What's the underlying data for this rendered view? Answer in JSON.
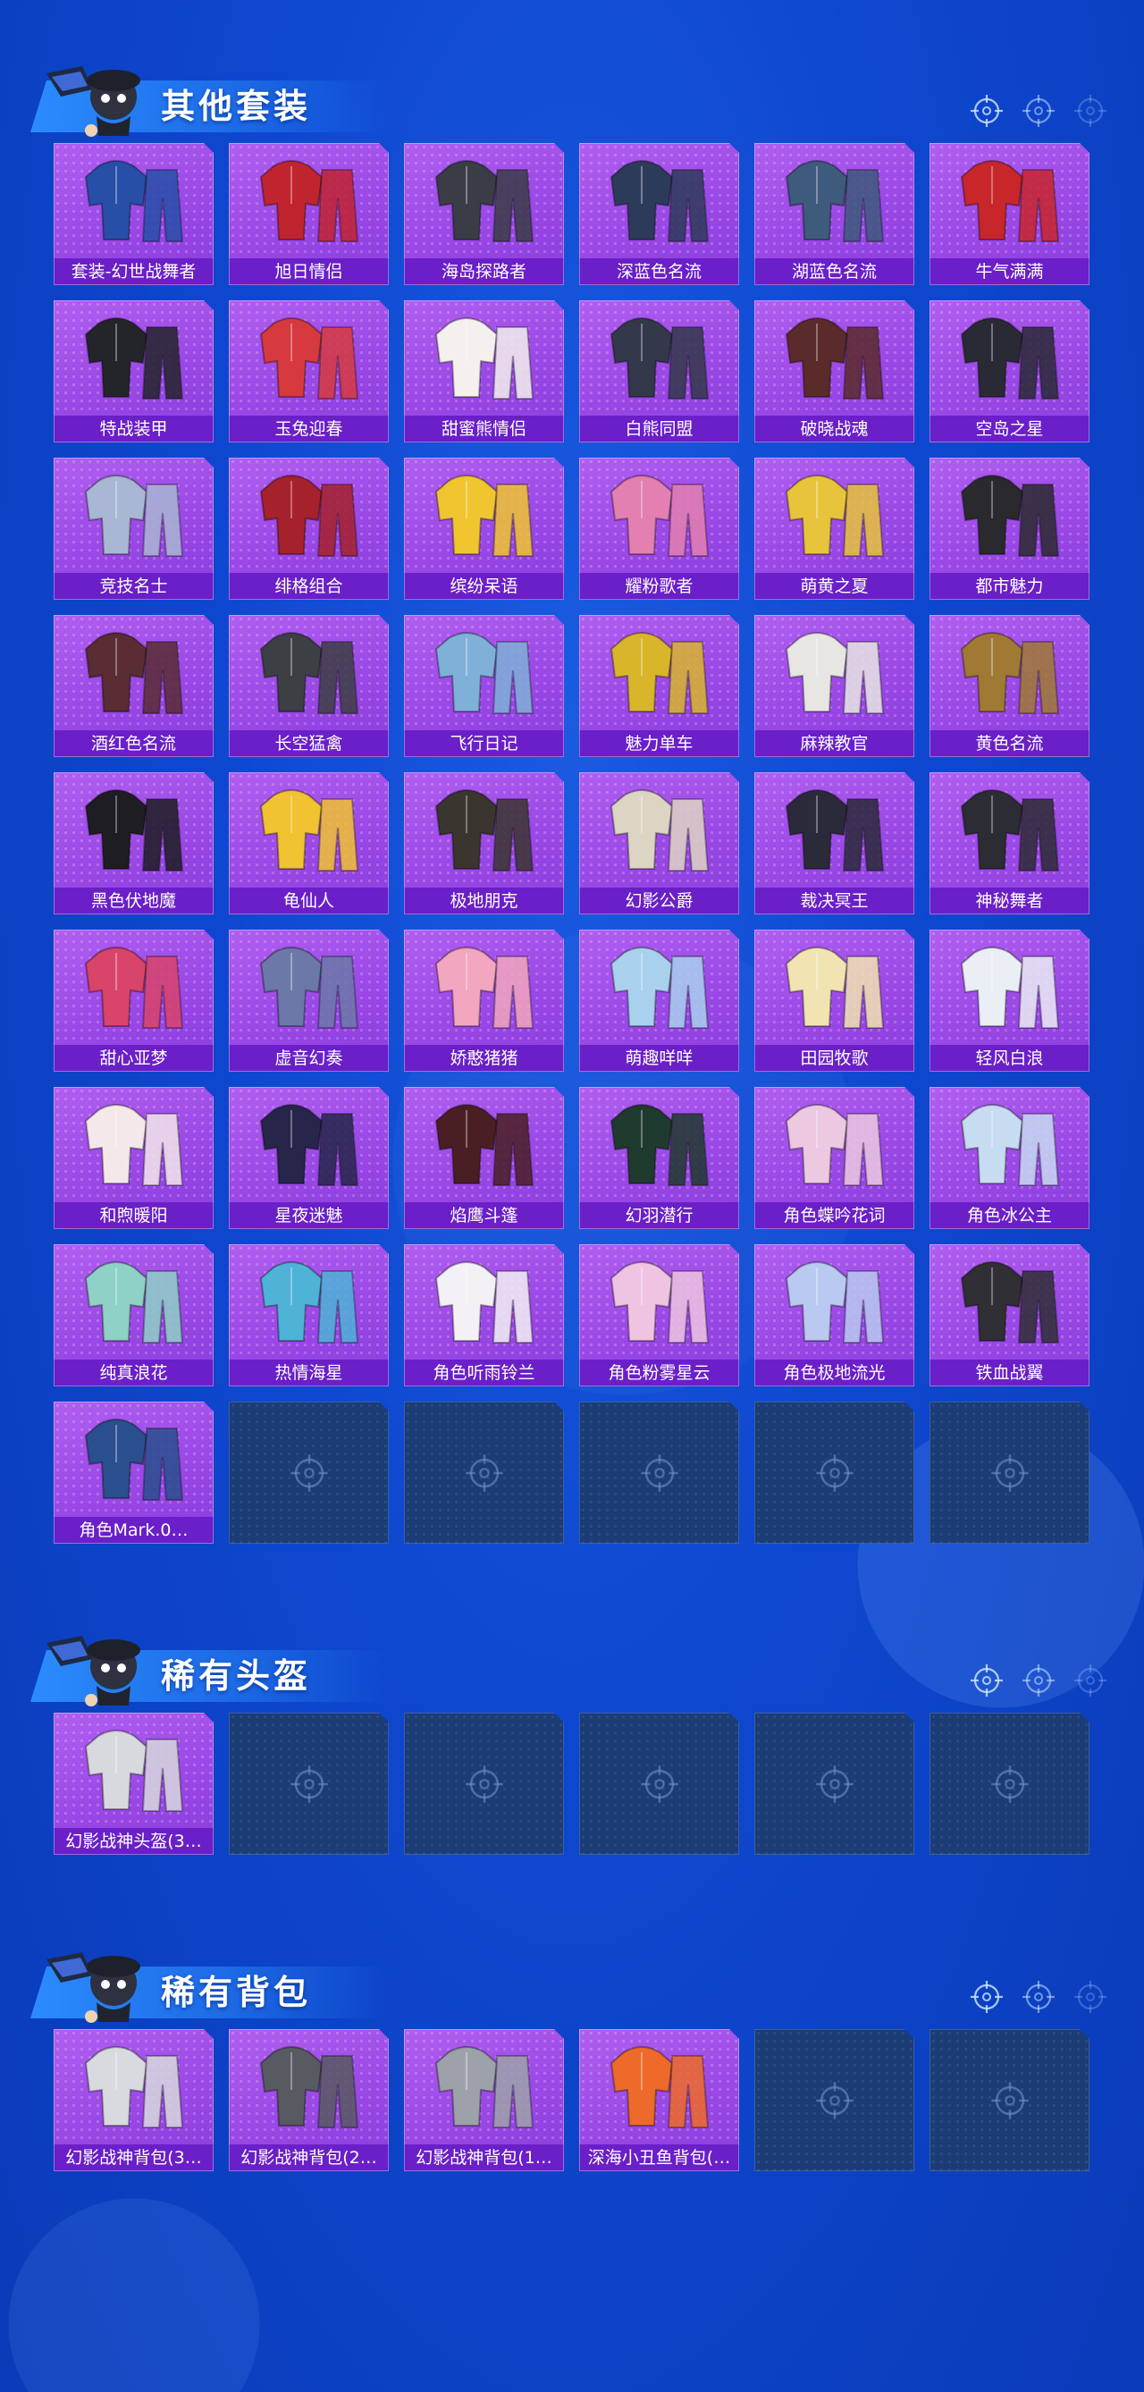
{
  "colors": {
    "background": "#0e47cf",
    "card_purple": "#9a48e6",
    "label_purple": "#6a1fc8",
    "empty_slot": "#1c3c76",
    "header_band": "#2b8cff"
  },
  "icons": {
    "mascot": "mascot-icon",
    "crosshair": "crosshair-icon"
  },
  "sections": [
    {
      "title": "其他套装",
      "items": [
        {
          "label": "套装-幻世战舞者",
          "art": "#274fa8"
        },
        {
          "label": "旭日情侣",
          "art": "#c0242f"
        },
        {
          "label": "海岛探路者",
          "art": "#3a3d46"
        },
        {
          "label": "深蓝色名流",
          "art": "#2d3b5a"
        },
        {
          "label": "湖蓝色名流",
          "art": "#3e5a7c"
        },
        {
          "label": "牛气满满",
          "art": "#c8262b"
        },
        {
          "label": "特战装甲",
          "art": "#23252b"
        },
        {
          "label": "玉兔迎春",
          "art": "#d63a3f"
        },
        {
          "label": "甜蜜熊情侣",
          "art": "#f3f0ee"
        },
        {
          "label": "白熊同盟",
          "art": "#33384a"
        },
        {
          "label": "破晓战魂",
          "art": "#5b2a2b"
        },
        {
          "label": "空岛之星",
          "art": "#2a2a36"
        },
        {
          "label": "竞技名士",
          "art": "#a9b6d4"
        },
        {
          "label": "绯格组合",
          "art": "#a5212b"
        },
        {
          "label": "缤纷呆语",
          "art": "#f1c530"
        },
        {
          "label": "耀粉歌者",
          "art": "#e37fb1"
        },
        {
          "label": "萌黄之夏",
          "art": "#e8c43c"
        },
        {
          "label": "都市魅力",
          "art": "#2a2a2e"
        },
        {
          "label": "酒红色名流",
          "art": "#5a2c34"
        },
        {
          "label": "长空猛禽",
          "art": "#3c3f44"
        },
        {
          "label": "飞行日记",
          "art": "#7fb0d8"
        },
        {
          "label": "魅力单车",
          "art": "#d9b52c"
        },
        {
          "label": "麻辣教官",
          "art": "#e8e6e3"
        },
        {
          "label": "黄色名流",
          "art": "#a07a34"
        },
        {
          "label": "黑色伏地魔",
          "art": "#1d1d22"
        },
        {
          "label": "龟仙人",
          "art": "#f1c232"
        },
        {
          "label": "极地朋克",
          "art": "#3a352f"
        },
        {
          "label": "幻影公爵",
          "art": "#ddd5c4"
        },
        {
          "label": "裁决冥王",
          "art": "#2b2a3a"
        },
        {
          "label": "神秘舞者",
          "art": "#2c2c34"
        },
        {
          "label": "甜心亚梦",
          "art": "#d9446a"
        },
        {
          "label": "虚音幻奏",
          "art": "#6c78a8"
        },
        {
          "label": "娇憨猪猪",
          "art": "#f3a6bf"
        },
        {
          "label": "萌趣咩咩",
          "art": "#a9d1ee"
        },
        {
          "label": "田园牧歌",
          "art": "#f2e4b2"
        },
        {
          "label": "轻风白浪",
          "art": "#eaeef5"
        },
        {
          "label": "和煦暖阳",
          "art": "#f4e8ea"
        },
        {
          "label": "星夜迷魅",
          "art": "#25264a"
        },
        {
          "label": "焰鹰斗篷",
          "art": "#4a1f24"
        },
        {
          "label": "幻羽潜行",
          "art": "#1f3a2e"
        },
        {
          "label": "角色蝶吟花词",
          "art": "#ecc9e1"
        },
        {
          "label": "角色冰公主",
          "art": "#c7dbf1"
        },
        {
          "label": "纯真浪花",
          "art": "#8fd0c7"
        },
        {
          "label": "热情海星",
          "art": "#4fb3d8"
        },
        {
          "label": "角色听雨铃兰",
          "art": "#f3f1f5"
        },
        {
          "label": "角色粉雾星云",
          "art": "#efc4e3"
        },
        {
          "label": "角色极地流光",
          "art": "#b9c9f1"
        },
        {
          "label": "铁血战翼",
          "art": "#2f2f35"
        },
        {
          "label": "角色Mark.0…",
          "art": "#2a4f8f"
        }
      ],
      "empty_slots": 5
    },
    {
      "title": "稀有头盔",
      "items": [
        {
          "label": "幻影战神头盔(3…",
          "art": "#d8d9de"
        }
      ],
      "empty_slots": 5
    },
    {
      "title": "稀有背包",
      "items": [
        {
          "label": "幻影战神背包(3…",
          "art": "#d8dadf"
        },
        {
          "label": "幻影战神背包(2…",
          "art": "#585a62"
        },
        {
          "label": "幻影战神背包(1…",
          "art": "#9da2aa"
        },
        {
          "label": "深海小丑鱼背包(…",
          "art": "#ee6a2a"
        }
      ],
      "empty_slots": 2
    }
  ]
}
